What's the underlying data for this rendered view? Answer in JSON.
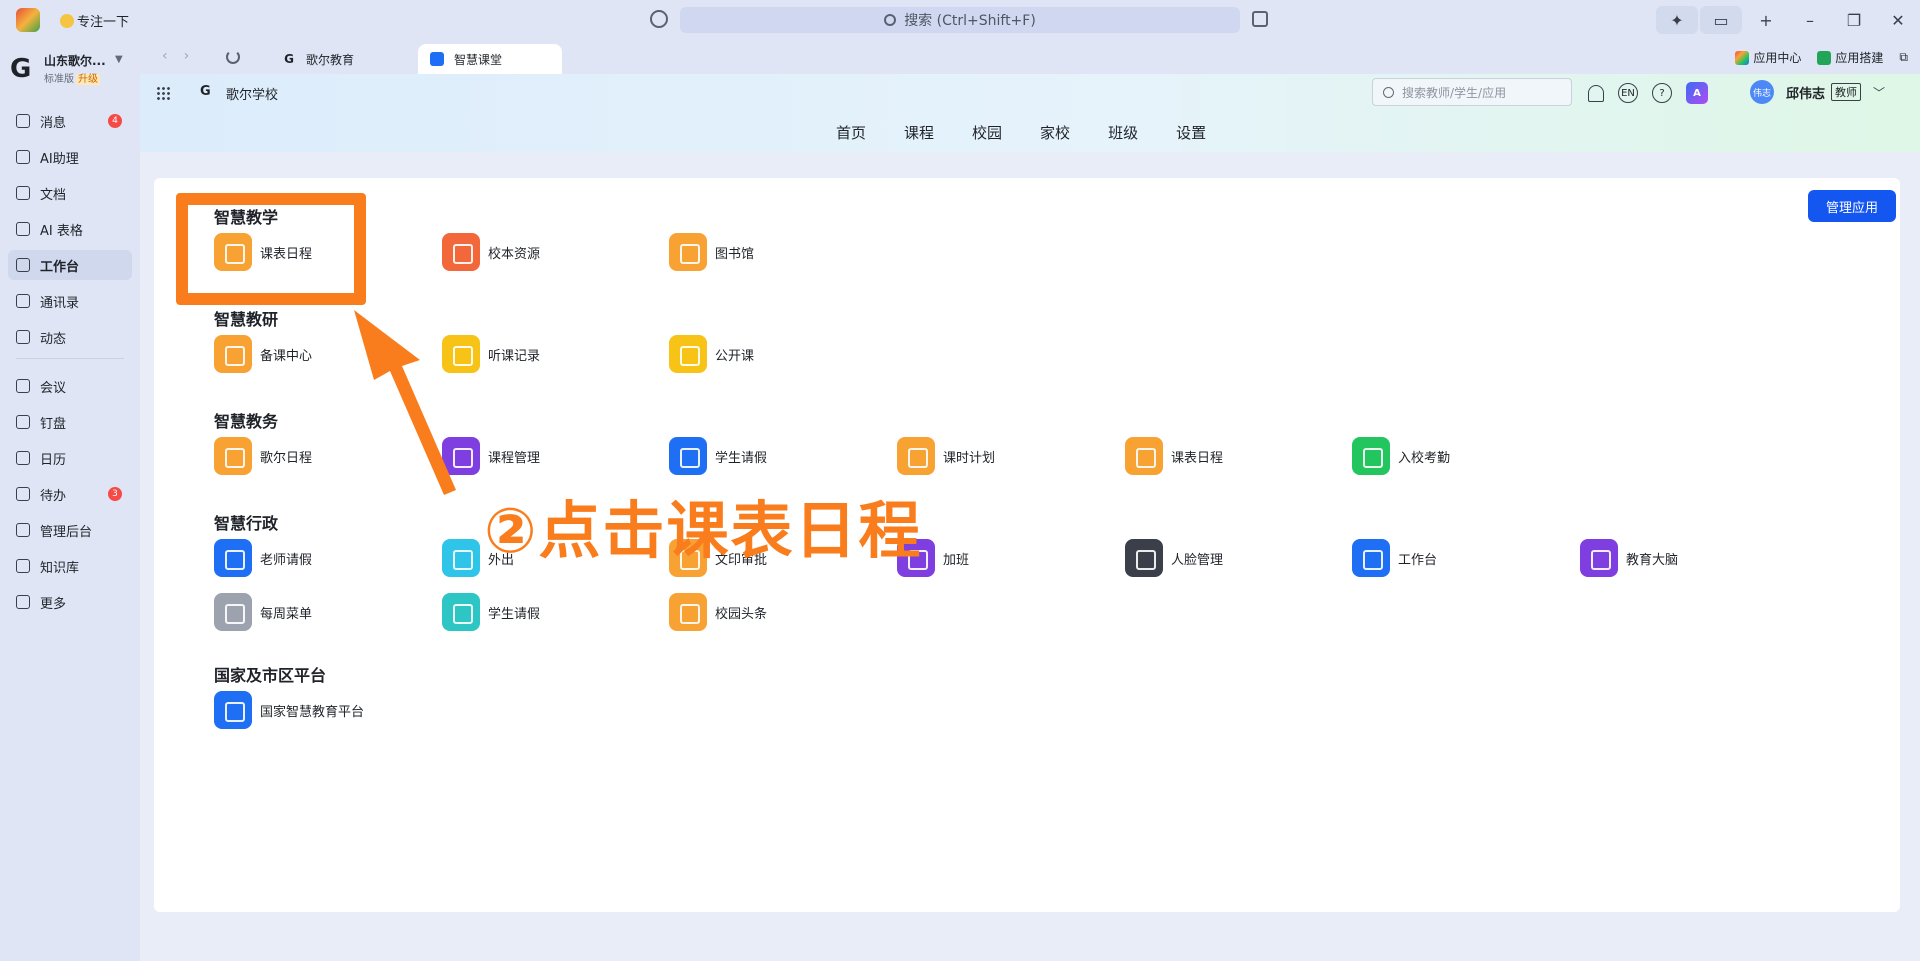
{
  "titlebar": {
    "focus_label": "专注一下",
    "search_placeholder": "搜索 (Ctrl+Shift+F)"
  },
  "sidebar": {
    "org_name": "山东歌尔...",
    "org_logo": "G",
    "edition": "标准版",
    "upgrade": "升级",
    "items": [
      {
        "label": "消息",
        "badge": "4",
        "icon": "message-icon"
      },
      {
        "label": "AI助理",
        "icon": "ai-assistant-icon"
      },
      {
        "label": "文档",
        "icon": "document-icon"
      },
      {
        "label": "AI 表格",
        "icon": "table-icon"
      },
      {
        "label": "工作台",
        "icon": "workbench-icon",
        "active": true
      },
      {
        "label": "通讯录",
        "icon": "contacts-icon"
      },
      {
        "label": "动态",
        "icon": "moments-icon"
      },
      {
        "label": "会议",
        "icon": "meeting-icon"
      },
      {
        "label": "钉盘",
        "icon": "drive-icon"
      },
      {
        "label": "日历",
        "icon": "calendar-icon"
      },
      {
        "label": "待办",
        "badge": "3",
        "icon": "todo-icon"
      },
      {
        "label": "管理后台",
        "icon": "admin-icon"
      },
      {
        "label": "知识库",
        "icon": "knowledge-icon"
      },
      {
        "label": "更多",
        "icon": "more-icon"
      }
    ]
  },
  "tabs": {
    "tab1": "歌尔教育",
    "tab2": "智慧课堂",
    "app_center": "应用中心",
    "app_builder": "应用搭建"
  },
  "header": {
    "school_logo": "G",
    "school_name": "歌尔学校",
    "search_placeholder": "搜索教师/学生/应用",
    "lang": "EN",
    "help": "?",
    "avatar_text": "伟志",
    "user_name": "邱伟志",
    "role": "教师",
    "nav": [
      "首页",
      "课程",
      "校园",
      "家校",
      "班级",
      "设置"
    ]
  },
  "card": {
    "manage_button": "管理应用",
    "sections": [
      {
        "title": "智慧教学",
        "apps": [
          {
            "label": "课表日程",
            "color": "#f9a234"
          },
          {
            "label": "校本资源",
            "color": "#f2683a"
          },
          {
            "label": "图书馆",
            "color": "#f9a234"
          }
        ]
      },
      {
        "title": "智慧教研",
        "apps": [
          {
            "label": "备课中心",
            "color": "#f9a234"
          },
          {
            "label": "听课记录",
            "color": "#f7c316"
          },
          {
            "label": "公开课",
            "color": "#f7c316"
          }
        ]
      },
      {
        "title": "智慧教务",
        "apps": [
          {
            "label": "歌尔日程",
            "color": "#f9a234"
          },
          {
            "label": "课程管理",
            "color": "#7f3fe0"
          },
          {
            "label": "学生请假",
            "color": "#1e6ff3"
          },
          {
            "label": "课时计划",
            "color": "#f9a234"
          },
          {
            "label": "课表日程",
            "color": "#f9a234"
          },
          {
            "label": "入校考勤",
            "color": "#22c55e"
          }
        ]
      },
      {
        "title": "智慧行政",
        "apps": [
          {
            "label": "老师请假",
            "color": "#1e6ff3"
          },
          {
            "label": "外出",
            "color": "#2ec5e8"
          },
          {
            "label": "文印审批",
            "color": "#f9a234"
          },
          {
            "label": "加班",
            "color": "#7f3fe0"
          },
          {
            "label": "人脸管理",
            "color": "#3a3f4a"
          },
          {
            "label": "工作台",
            "color": "#1e6ff3"
          },
          {
            "label": "教育大脑",
            "color": "#7f3fe0"
          },
          {
            "label": "每周菜单",
            "color": "#9ca3af"
          },
          {
            "label": "学生请假",
            "color": "#2ec5c5"
          },
          {
            "label": "校园头条",
            "color": "#f9a234"
          }
        ]
      },
      {
        "title": "国家及市区平台",
        "apps": [
          {
            "label": "国家智慧教育平台",
            "color": "#1e6ff3"
          }
        ]
      }
    ]
  },
  "annotation": {
    "text": "②点击课表日程",
    "color": "#f97d1c"
  }
}
